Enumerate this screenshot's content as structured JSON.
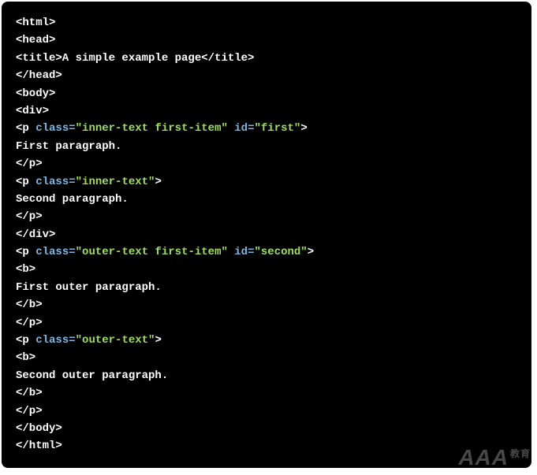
{
  "code": {
    "lines": [
      [
        {
          "t": "<html>",
          "c": "c-white"
        }
      ],
      [
        {
          "t": "<head>",
          "c": "c-white"
        }
      ],
      [
        {
          "t": "<title>A simple example page</title>",
          "c": "c-white"
        }
      ],
      [
        {
          "t": "</head>",
          "c": "c-white"
        }
      ],
      [
        {
          "t": "<body>",
          "c": "c-white"
        }
      ],
      [
        {
          "t": "<div>",
          "c": "c-white"
        }
      ],
      [
        {
          "t": "<p ",
          "c": "c-white"
        },
        {
          "t": "class",
          "c": "c-attr"
        },
        {
          "t": "=",
          "c": "c-eq"
        },
        {
          "t": "\"inner-text first-item\"",
          "c": "c-str"
        },
        {
          "t": " ",
          "c": "c-white"
        },
        {
          "t": "id",
          "c": "c-attr"
        },
        {
          "t": "=",
          "c": "c-eq"
        },
        {
          "t": "\"first\"",
          "c": "c-str"
        },
        {
          "t": ">",
          "c": "c-white"
        }
      ],
      [
        {
          "t": "First paragraph.",
          "c": "c-white"
        }
      ],
      [
        {
          "t": "</p>",
          "c": "c-white"
        }
      ],
      [
        {
          "t": "<p ",
          "c": "c-white"
        },
        {
          "t": "class",
          "c": "c-attr"
        },
        {
          "t": "=",
          "c": "c-eq"
        },
        {
          "t": "\"inner-text\"",
          "c": "c-str"
        },
        {
          "t": ">",
          "c": "c-white"
        }
      ],
      [
        {
          "t": "Second paragraph.",
          "c": "c-white"
        }
      ],
      [
        {
          "t": "</p>",
          "c": "c-white"
        }
      ],
      [
        {
          "t": "</div>",
          "c": "c-white"
        }
      ],
      [
        {
          "t": "<p ",
          "c": "c-white"
        },
        {
          "t": "class",
          "c": "c-attr"
        },
        {
          "t": "=",
          "c": "c-eq"
        },
        {
          "t": "\"outer-text first-item\"",
          "c": "c-str"
        },
        {
          "t": " ",
          "c": "c-white"
        },
        {
          "t": "id",
          "c": "c-attr"
        },
        {
          "t": "=",
          "c": "c-eq"
        },
        {
          "t": "\"second\"",
          "c": "c-str"
        },
        {
          "t": ">",
          "c": "c-white"
        }
      ],
      [
        {
          "t": "<b>",
          "c": "c-white"
        }
      ],
      [
        {
          "t": "First outer paragraph.",
          "c": "c-white"
        }
      ],
      [
        {
          "t": "</b>",
          "c": "c-white"
        }
      ],
      [
        {
          "t": "</p>",
          "c": "c-white"
        }
      ],
      [
        {
          "t": "<p ",
          "c": "c-white"
        },
        {
          "t": "class",
          "c": "c-attr"
        },
        {
          "t": "=",
          "c": "c-eq"
        },
        {
          "t": "\"outer-text\"",
          "c": "c-str"
        },
        {
          "t": ">",
          "c": "c-white"
        }
      ],
      [
        {
          "t": "<b>",
          "c": "c-white"
        }
      ],
      [
        {
          "t": "Second outer paragraph.",
          "c": "c-white"
        }
      ],
      [
        {
          "t": "</b>",
          "c": "c-white"
        }
      ],
      [
        {
          "t": "</p>",
          "c": "c-white"
        }
      ],
      [
        {
          "t": "</body>",
          "c": "c-white"
        }
      ],
      [
        {
          "t": "</html>",
          "c": "c-white"
        }
      ]
    ]
  },
  "watermark": {
    "main": "AAA",
    "suffix": "教育"
  }
}
